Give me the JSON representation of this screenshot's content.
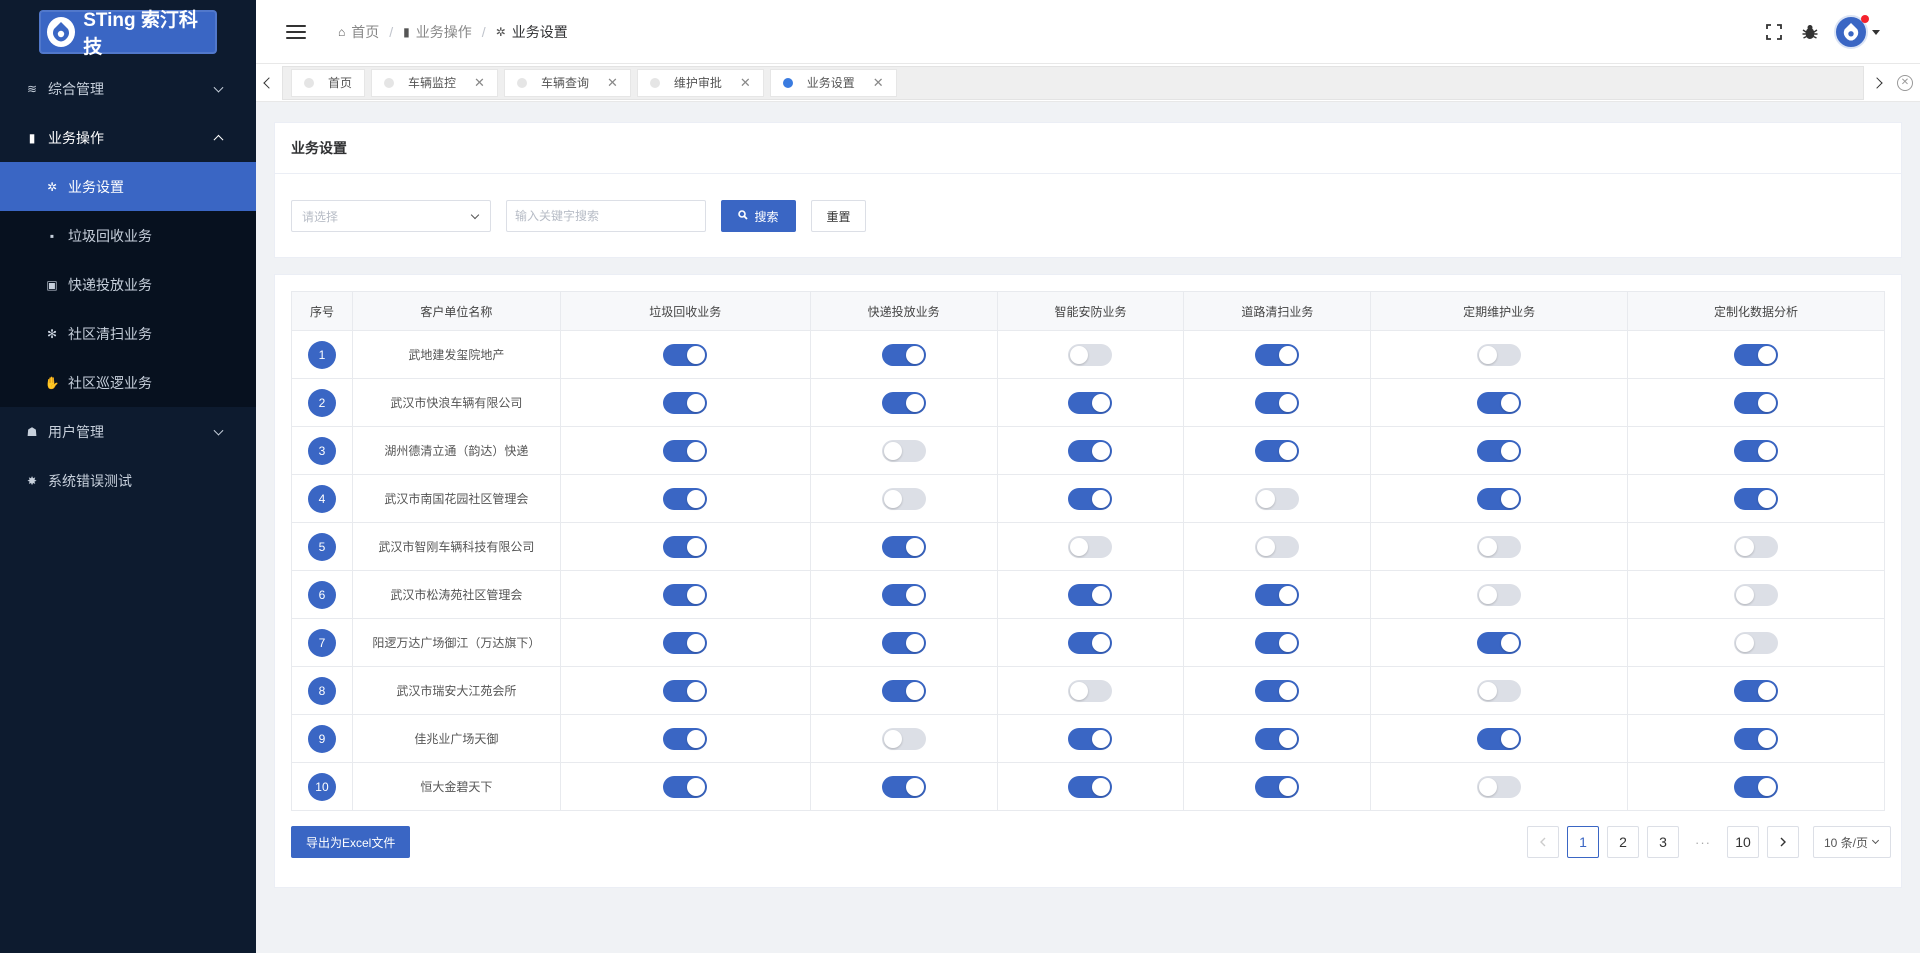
{
  "brand": {
    "name": "STing 索汀科技"
  },
  "sidebar": {
    "items": [
      {
        "label": "综合管理",
        "icon": "layers-icon",
        "glyph": "≋",
        "expandable": true,
        "open": false
      },
      {
        "label": "业务操作",
        "icon": "bar-chart-icon",
        "glyph": "▮",
        "expandable": true,
        "open": true,
        "children": [
          {
            "label": "业务设置",
            "icon": "gear-icon",
            "glyph": "✲",
            "active": true
          },
          {
            "label": "垃圾回收业务",
            "icon": "trash-icon",
            "glyph": "▪"
          },
          {
            "label": "快递投放业务",
            "icon": "package-icon",
            "glyph": "▣"
          },
          {
            "label": "社区清扫业务",
            "icon": "snowflake-icon",
            "glyph": "✻"
          },
          {
            "label": "社区巡逻业务",
            "icon": "hand-icon",
            "glyph": "✋"
          }
        ]
      },
      {
        "label": "用户管理",
        "icon": "users-icon",
        "glyph": "☗",
        "expandable": true,
        "open": false
      },
      {
        "label": "系统错误测试",
        "icon": "bug-icon",
        "glyph": "✸",
        "expandable": false
      }
    ]
  },
  "header": {
    "breadcrumb": [
      {
        "label": "首页",
        "icon": "home-icon",
        "glyph": "⌂"
      },
      {
        "label": "业务操作",
        "icon": "bar-chart-icon",
        "glyph": "▮"
      },
      {
        "label": "业务设置",
        "icon": "gear-icon",
        "glyph": "✲"
      }
    ]
  },
  "tabs": [
    {
      "label": "首页",
      "closable": false,
      "active": false
    },
    {
      "label": "车辆监控",
      "closable": true,
      "active": false
    },
    {
      "label": "车辆查询",
      "closable": true,
      "active": false
    },
    {
      "label": "维护审批",
      "closable": true,
      "active": false
    },
    {
      "label": "业务设置",
      "closable": true,
      "active": true
    }
  ],
  "page": {
    "title": "业务设置",
    "filters": {
      "select_placeholder": "请选择",
      "search_placeholder": "输入关键字搜索",
      "search_label": "搜索",
      "reset_label": "重置"
    }
  },
  "table": {
    "columns": [
      "序号",
      "客户单位名称",
      "垃圾回收业务",
      "快递投放业务",
      "智能安防业务",
      "道路清扫业务",
      "定期维护业务",
      "定制化数据分析"
    ],
    "rows": [
      {
        "no": "1",
        "name": "武地建发玺院地产",
        "toggles": [
          true,
          true,
          false,
          true,
          false,
          true
        ]
      },
      {
        "no": "2",
        "name": "武汉市快浪车辆有限公司",
        "toggles": [
          true,
          true,
          true,
          true,
          true,
          true
        ]
      },
      {
        "no": "3",
        "name": "湖州德清立通（韵达）快递",
        "toggles": [
          true,
          false,
          true,
          true,
          true,
          true
        ]
      },
      {
        "no": "4",
        "name": "武汉市南国花园社区管理会",
        "toggles": [
          true,
          false,
          true,
          false,
          true,
          true
        ]
      },
      {
        "no": "5",
        "name": "武汉市智刚车辆科技有限公司",
        "toggles": [
          true,
          true,
          false,
          false,
          false,
          false
        ]
      },
      {
        "no": "6",
        "name": "武汉市松涛苑社区管理会",
        "toggles": [
          true,
          true,
          true,
          true,
          false,
          false
        ]
      },
      {
        "no": "7",
        "name": "阳逻万达广场御江（万达旗下）",
        "toggles": [
          true,
          true,
          true,
          true,
          true,
          false
        ]
      },
      {
        "no": "8",
        "name": "武汉市瑞安大江苑会所",
        "toggles": [
          true,
          true,
          false,
          true,
          false,
          true
        ]
      },
      {
        "no": "9",
        "name": "佳兆业广场天御",
        "toggles": [
          true,
          false,
          true,
          true,
          true,
          true
        ]
      },
      {
        "no": "10",
        "name": "恒大金碧天下",
        "toggles": [
          true,
          true,
          true,
          true,
          false,
          true
        ]
      }
    ]
  },
  "footer": {
    "export_label": "导出为Excel文件",
    "pagination": {
      "pages": [
        "1",
        "2",
        "3"
      ],
      "ellipsis": "···",
      "last": "10",
      "current": "1",
      "page_size": "10 条/页"
    }
  },
  "colors": {
    "primary": "#3a66c4",
    "sidebar_bg": "#0d1b2f",
    "toggle_off": "#dcdfe6"
  }
}
